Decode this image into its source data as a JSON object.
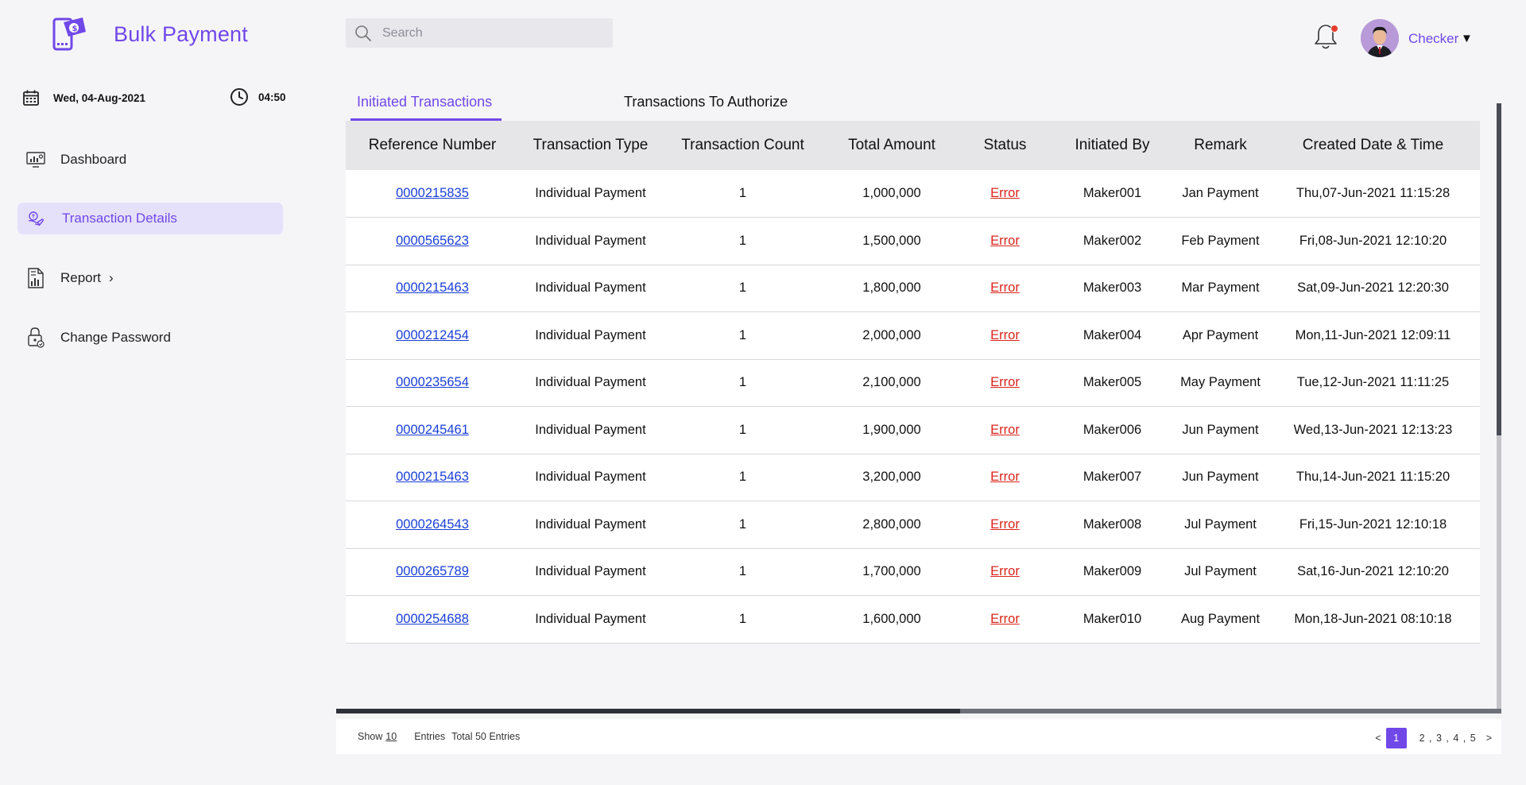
{
  "app": {
    "title": "Bulk Payment"
  },
  "header": {
    "search_placeholder": "Search",
    "user_name": "Checker",
    "user_caret": "▼"
  },
  "sidebar": {
    "date": "Wed, 04-Aug-2021",
    "time": "04:50",
    "items": [
      {
        "label": "Dashboard",
        "icon": "dashboard-icon"
      },
      {
        "label": "Transaction Details",
        "icon": "transaction-icon",
        "active": true
      },
      {
        "label": "Report",
        "icon": "report-icon",
        "chevron": "›"
      },
      {
        "label": "Change Password",
        "icon": "lock-icon"
      }
    ]
  },
  "tabs": [
    {
      "label": "Initiated Transactions",
      "active": true
    },
    {
      "label": "Transactions To Authorize"
    }
  ],
  "table": {
    "headers": [
      "Reference Number",
      "Transaction Type",
      "Transaction Count",
      "Total Amount",
      "Status",
      "Initiated By",
      "Remark",
      "Created Date & Time"
    ],
    "rows": [
      [
        "0000215835",
        "Individual Payment",
        "1",
        "1,000,000",
        "Error",
        "Maker001",
        "Jan Payment",
        "Thu,07-Jun-2021  11:15:28"
      ],
      [
        "0000565623",
        "Individual Payment",
        "1",
        "1,500,000",
        "Error",
        "Maker002",
        "Feb Payment",
        "Fri,08-Jun-2021  12:10:20"
      ],
      [
        "0000215463",
        "Individual Payment",
        "1",
        "1,800,000",
        "Error",
        "Maker003",
        "Mar Payment",
        "Sat,09-Jun-2021  12:20:30"
      ],
      [
        "0000212454",
        "Individual Payment",
        "1",
        "2,000,000",
        "Error",
        "Maker004",
        "Apr Payment",
        "Mon,11-Jun-2021 12:09:11"
      ],
      [
        "0000235654",
        "Individual Payment",
        "1",
        "2,100,000",
        "Error",
        "Maker005",
        "May Payment",
        "Tue,12-Jun-2021  11:11:25"
      ],
      [
        "0000245461",
        "Individual Payment",
        "1",
        "1,900,000",
        "Error",
        "Maker006",
        "Jun Payment",
        "Wed,13-Jun-2021 12:13:23"
      ],
      [
        "0000215463",
        "Individual Payment",
        "1",
        "3,200,000",
        "Error",
        "Maker007",
        "Jun Payment",
        "Thu,14-Jun-2021  11:15:20"
      ],
      [
        "0000264543",
        "Individual Payment",
        "1",
        "2,800,000",
        "Error",
        "Maker008",
        "Jul Payment",
        "Fri,15-Jun-2021  12:10:18"
      ],
      [
        "0000265789",
        "Individual Payment",
        "1",
        "1,700,000",
        "Error",
        "Maker009",
        "Jul Payment",
        "Sat,16-Jun-2021  12:10:20"
      ],
      [
        "0000254688",
        "Individual Payment",
        "1",
        "1,600,000",
        "Error",
        "Maker010",
        "Aug Payment",
        "Mon,18-Jun-2021 08:10:18"
      ]
    ]
  },
  "footer": {
    "show_label": "Show",
    "show_count": "10",
    "entries_label": "Entries",
    "total_label": "Total 50 Entries",
    "prev": "<",
    "current_page": "1",
    "other_pages": "2 , 3 , 4 , 5",
    "next": ">"
  },
  "colors": {
    "accent": "#7048e8",
    "error": "#d9261c",
    "link": "#1a3fd6",
    "active_nav_bg": "#e6e1fb"
  }
}
